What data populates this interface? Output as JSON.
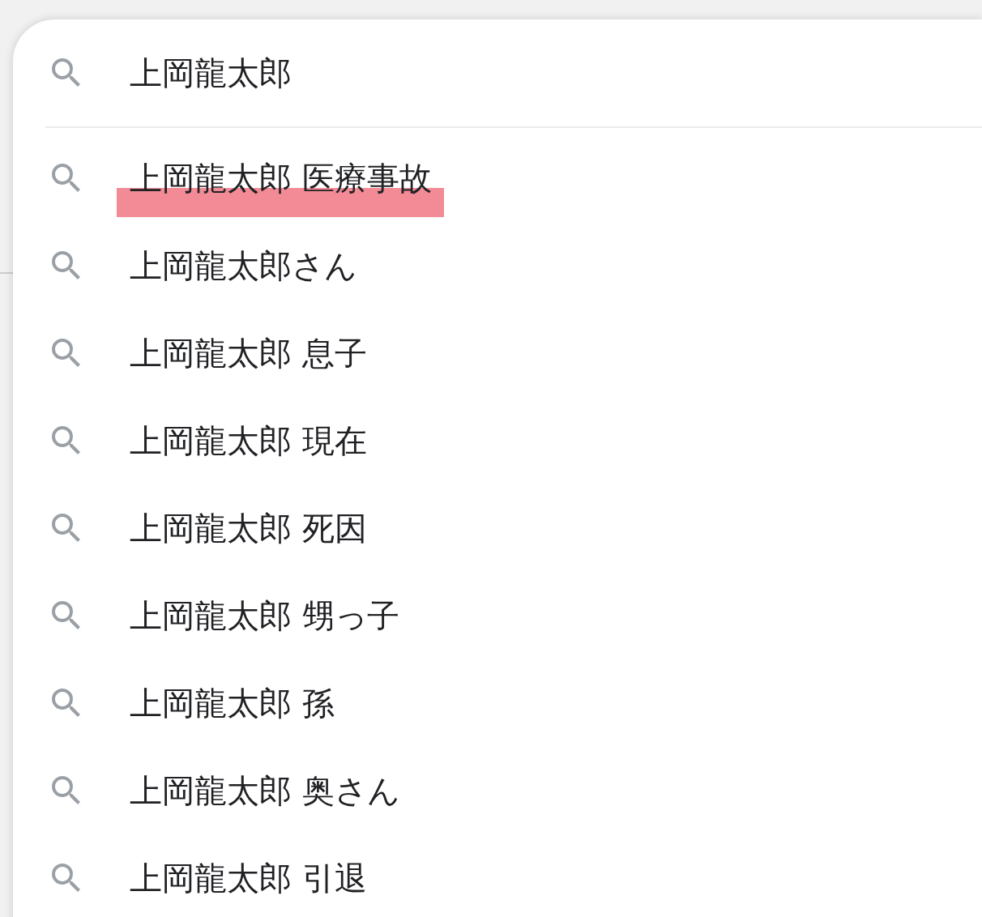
{
  "search": {
    "value": "上岡龍太郎"
  },
  "suggestions": [
    {
      "text": "上岡龍太郎 医療事故",
      "highlighted": true
    },
    {
      "text": "上岡龍太郎さん",
      "highlighted": false
    },
    {
      "text": "上岡龍太郎 息子",
      "highlighted": false
    },
    {
      "text": "上岡龍太郎 現在",
      "highlighted": false
    },
    {
      "text": "上岡龍太郎 死因",
      "highlighted": false
    },
    {
      "text": "上岡龍太郎 甥っ子",
      "highlighted": false
    },
    {
      "text": "上岡龍太郎 孫",
      "highlighted": false
    },
    {
      "text": "上岡龍太郎 奥さん",
      "highlighted": false
    },
    {
      "text": "上岡龍太郎 引退",
      "highlighted": false
    }
  ]
}
